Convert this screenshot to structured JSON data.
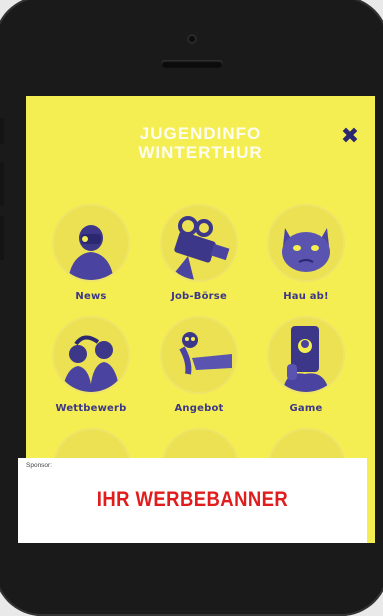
{
  "app": {
    "logo_line1": "JUGENDINFO",
    "logo_line2": "WINTERTHUR",
    "close_icon": "close-icon",
    "accent_color": "#f4ee52",
    "ink_color": "#3d3789"
  },
  "menu": {
    "items": [
      {
        "label": "News",
        "icon": "person-with-camera-icon"
      },
      {
        "label": "Job-Börse",
        "icon": "film-camera-icon"
      },
      {
        "label": "Hau ab!",
        "icon": "grumpy-cat-icon"
      },
      {
        "label": "Wettbewerb",
        "icon": "couple-photo-icon"
      },
      {
        "label": "Angebot",
        "icon": "animal-hand-icon"
      },
      {
        "label": "Game",
        "icon": "phone-selfie-icon"
      }
    ]
  },
  "banner": {
    "sponsor_label": "Sponsor:",
    "title": "IHR WERBEBANNER",
    "title_color": "#e01c1c"
  }
}
